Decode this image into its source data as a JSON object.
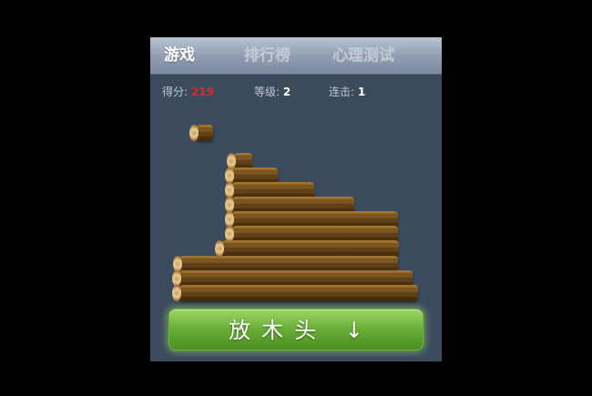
{
  "tabs": [
    {
      "label": "游戏",
      "active": true
    },
    {
      "label": "排行榜",
      "active": false
    },
    {
      "label": "心理测试",
      "active": false
    }
  ],
  "status": {
    "score_label": "得分:",
    "score_value": "219",
    "score_color": "#e0262b",
    "level_label": "等级:",
    "level_value": "2",
    "combo_label": "连击:",
    "combo_value": "1"
  },
  "action": {
    "drop_label": "放木头 ↓",
    "button_color": "#67ad35"
  },
  "icons": {
    "log": "wood-log-icon"
  }
}
